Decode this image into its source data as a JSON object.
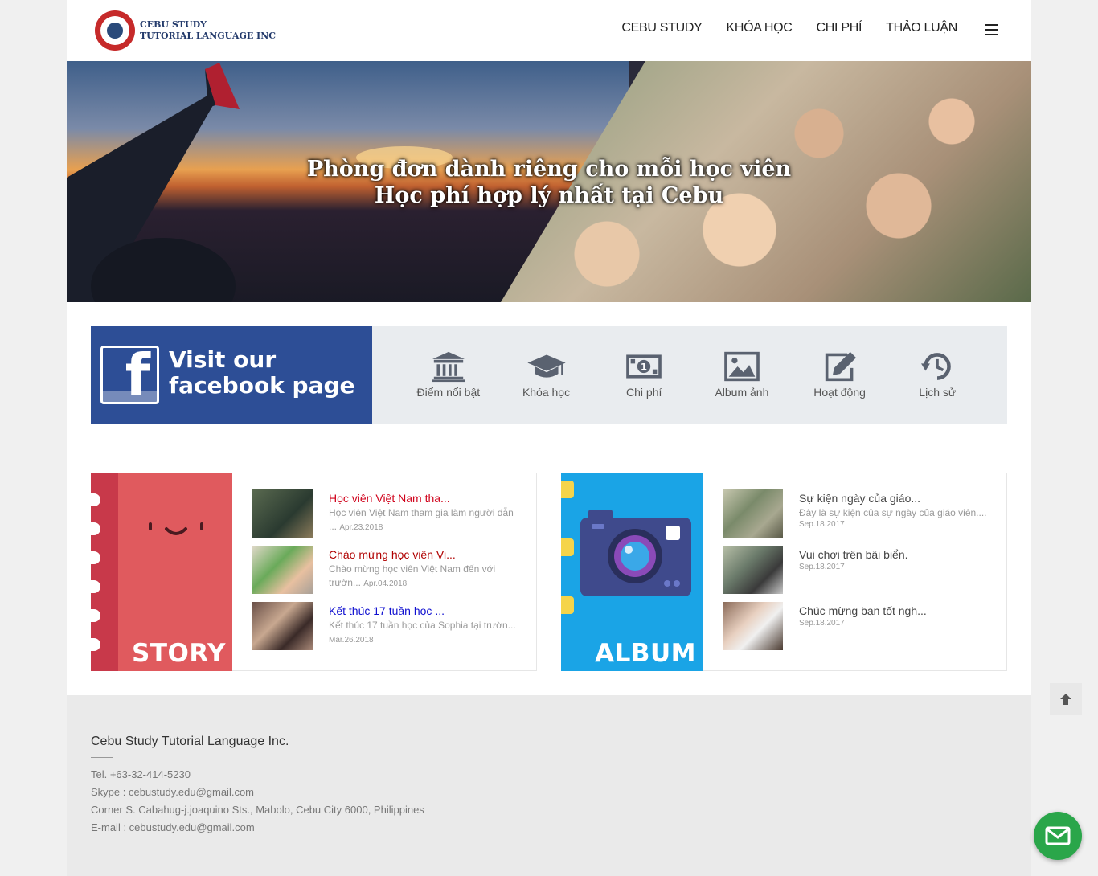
{
  "brand": {
    "name_line1": "CEBU STUDY",
    "name_line2": "TUTORIAL LANGUAGE INC"
  },
  "nav": {
    "items": [
      "CEBU STUDY",
      "KHÓA HỌC",
      "CHI PHÍ",
      "THẢO LUẬN"
    ],
    "menu_icon": "hamburger-icon"
  },
  "hero": {
    "line1": "Phòng đơn dành riêng cho mỗi học viên",
    "line2": "Học phí hợp lý nhất tại Cebu"
  },
  "facebook": {
    "line1": "Visit our",
    "line2": "facebook page"
  },
  "quick_links": [
    {
      "icon": "bank-icon",
      "label": "Điểm nổi bật"
    },
    {
      "icon": "graduation-cap-icon",
      "label": "Khóa học"
    },
    {
      "icon": "money-icon",
      "label": "Chi phí"
    },
    {
      "icon": "image-icon",
      "label": "Album ảnh"
    },
    {
      "icon": "edit-icon",
      "label": "Hoạt động"
    },
    {
      "icon": "history-icon",
      "label": "Lịch sử"
    }
  ],
  "story": {
    "label": "STORY",
    "items": [
      {
        "title": "Học viên Việt Nam tha...",
        "desc": "Học viên Việt Nam tham gia làm người dẫn ...",
        "date": "Apr.23.2018"
      },
      {
        "title": "Chào mừng học viên Vi...",
        "desc": "Chào mừng học viên Việt Nam đến với trườn...",
        "date": "Apr.04.2018"
      },
      {
        "title": "Kết thúc 17 tuần học ...",
        "desc": "Kết thúc 17 tuần học của Sophia tại trườn...",
        "date": "Mar.26.2018"
      }
    ]
  },
  "album": {
    "label": "ALBUM",
    "items": [
      {
        "title": "Sự kiện ngày của giáo...",
        "desc": "Đây là sự kiện của sự ngày của giáo viên....",
        "date": "Sep.18.2017"
      },
      {
        "title": "Vui chơi trên bãi biển.",
        "desc": "",
        "date": "Sep.18.2017"
      },
      {
        "title": "Chúc mừng bạn tốt ngh...",
        "desc": "",
        "date": "Sep.18.2017"
      }
    ]
  },
  "footer": {
    "company": "Cebu Study Tutorial Language Inc.",
    "tel": "Tel. +63-32-414-5230",
    "skype": "Skype : cebustudy.edu@gmail.com",
    "address": "Corner S. Cabahug-j.joaquino Sts., Mabolo, Cebu City 6000, Philippines",
    "email": "E-mail : cebustudy.edu@gmail.com"
  },
  "colors": {
    "facebook_blue": "#2d4e96",
    "story_red": "#e05a5e",
    "album_blue": "#1aa4e6",
    "mail_green": "#2aa64a"
  }
}
